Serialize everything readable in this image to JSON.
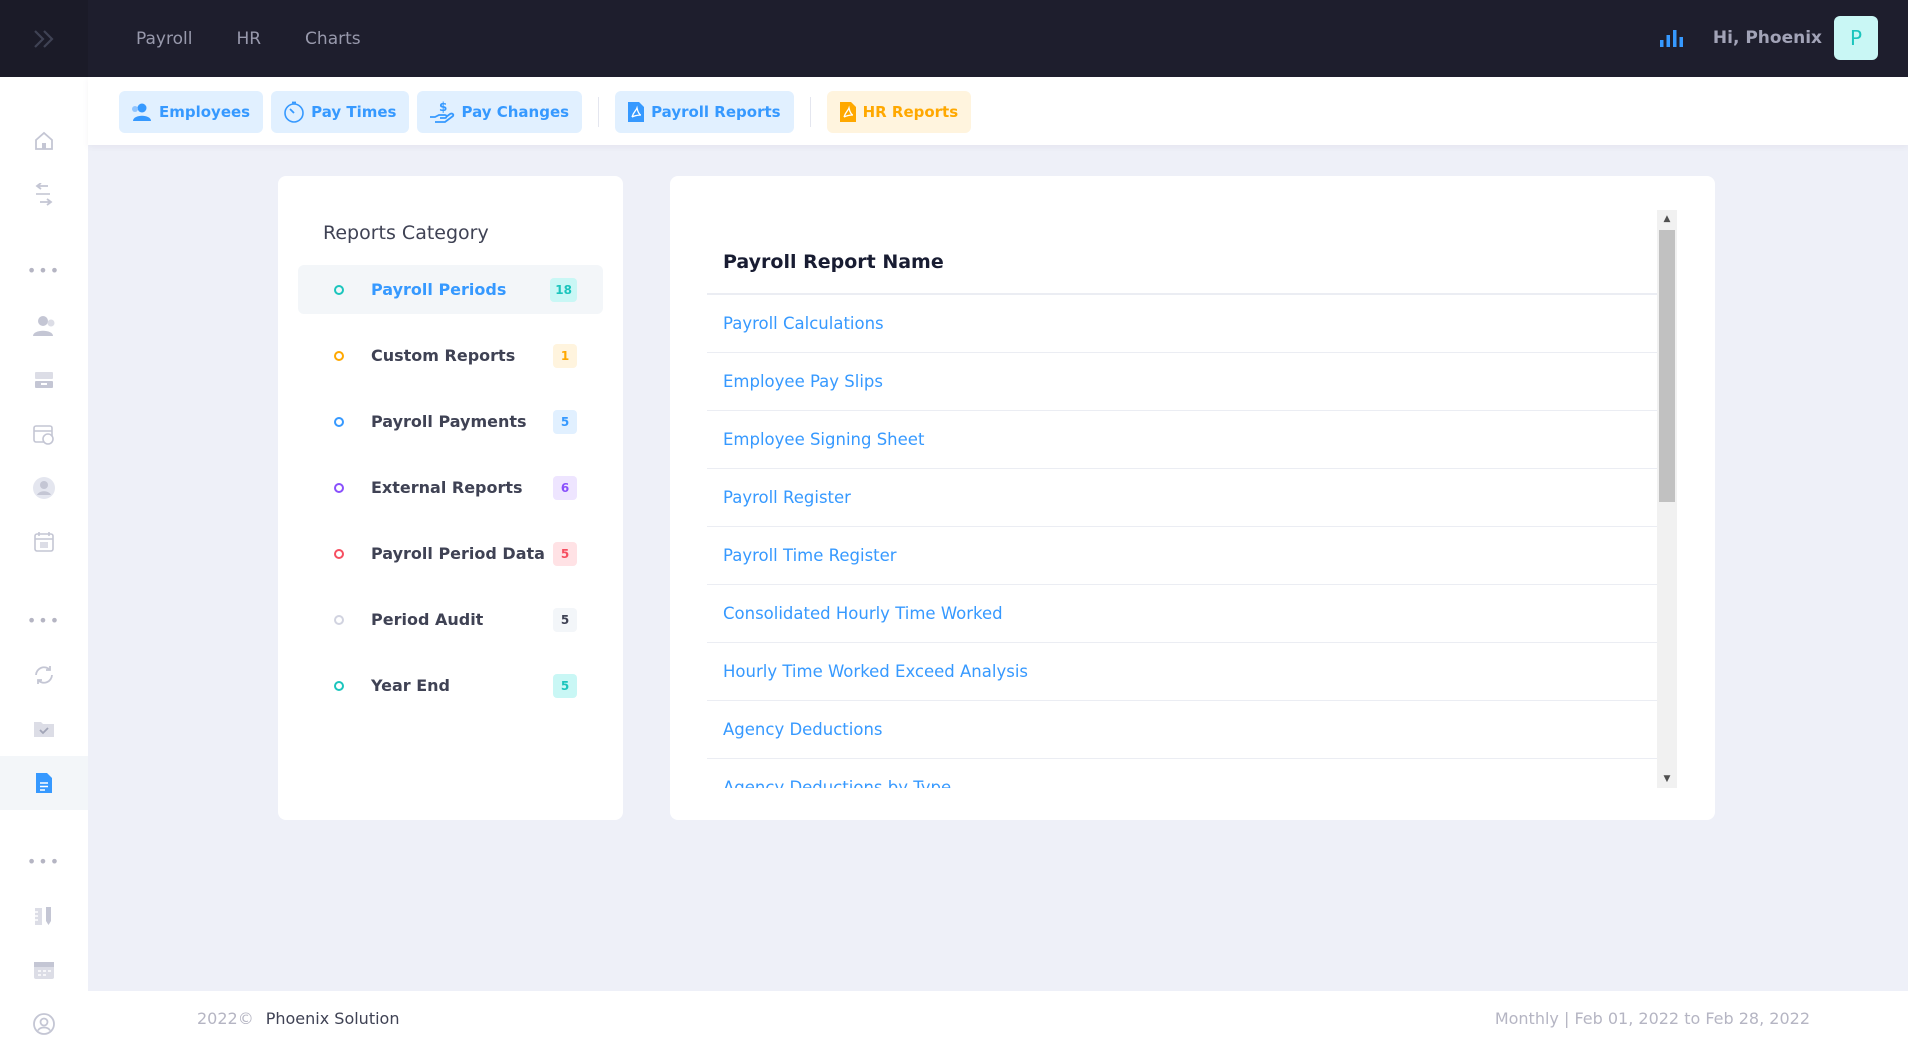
{
  "header": {
    "nav": [
      "Payroll",
      "HR",
      "Charts"
    ],
    "greeting": "Hi, Phoenix",
    "avatar_letter": "P"
  },
  "toolbar": {
    "buttons": [
      {
        "label": "Employees",
        "icon": "users-icon"
      },
      {
        "label": "Pay Times",
        "icon": "stopwatch-icon"
      },
      {
        "label": "Pay Changes",
        "icon": "hand-dollar-icon"
      },
      {
        "label": "Payroll Reports",
        "icon": "pdf-file-icon"
      },
      {
        "label": "HR Reports",
        "icon": "pdf-file-icon"
      }
    ]
  },
  "categories": {
    "title": "Reports Category",
    "items": [
      {
        "label": "Payroll Periods",
        "count": "18",
        "color": "#1bc5bd",
        "badge_bg": "#c9f7f5",
        "active": true
      },
      {
        "label": "Custom Reports",
        "count": "1",
        "color": "#ffa800",
        "badge_bg": "#fff4de"
      },
      {
        "label": "Payroll Payments",
        "count": "5",
        "color": "#3699ff",
        "badge_bg": "#e1f0ff"
      },
      {
        "label": "External Reports",
        "count": "6",
        "color": "#8950fc",
        "badge_bg": "#eee5ff"
      },
      {
        "label": "Payroll Period Data",
        "count": "5",
        "color": "#f64e60",
        "badge_bg": "#ffe2e5"
      },
      {
        "label": "Period Audit",
        "count": "5",
        "color": "#d1d3e0",
        "badge_bg": "#f3f6f9"
      },
      {
        "label": "Year End",
        "count": "5",
        "color": "#1bc5bd",
        "badge_bg": "#c9f7f5"
      }
    ]
  },
  "reports": {
    "header": "Payroll Report Name",
    "rows": [
      "Payroll Calculations",
      "Employee Pay Slips",
      "Employee Signing Sheet",
      "Payroll Register",
      "Payroll Time Register",
      "Consolidated Hourly Time Worked",
      "Hourly Time Worked Exceed Analysis",
      "Agency Deductions",
      "Agency Deductions by Type"
    ]
  },
  "footer": {
    "year": "2022©",
    "company": "Phoenix Solution",
    "period": "Monthly | Feb 01, 2022 to Feb 28, 2022"
  },
  "colors": {
    "accent": "#3699ff",
    "warning": "#ffa800",
    "dark_header": "#1e1e2d"
  }
}
